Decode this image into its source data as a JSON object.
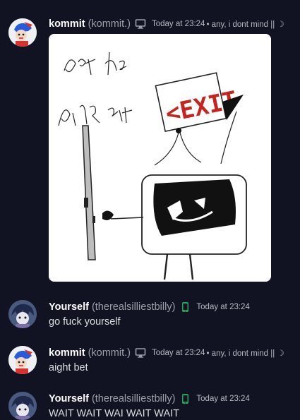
{
  "messages": [
    {
      "username": "kommit",
      "handle": "(kommit.)",
      "device_icon": "desktop-icon",
      "timestamp": "Today at 23:24",
      "status": "• any, i dont mind || ☽",
      "attachment": {
        "type": "drawing",
        "handwritten_text_line1": "get the",
        "handwritten_text_line2": "fuck out",
        "sign_text": "<EXIT"
      }
    },
    {
      "username": "Yourself",
      "handle": "(therealsilliestbilly)",
      "device_icon": "mobile-phone-icon",
      "timestamp": "Today at 23:24",
      "text": "go fuck yourself"
    },
    {
      "username": "kommit",
      "handle": "(kommit.)",
      "device_icon": "desktop-icon",
      "timestamp": "Today at 23:24",
      "status": "• any, i dont mind || ☽",
      "text": "aight bet"
    },
    {
      "username": "Yourself",
      "handle": "(therealsilliestbilly)",
      "device_icon": "mobile-phone-icon",
      "timestamp": "Today at 23:24",
      "text": "WAIT WAIT WAI WAIT WAIT"
    }
  ],
  "colors": {
    "background": "#121322",
    "username": "#ffffff",
    "handle": "#9aa0a8",
    "mobile_icon": "#23a55a",
    "exit_sign_red": "#c6241f"
  }
}
